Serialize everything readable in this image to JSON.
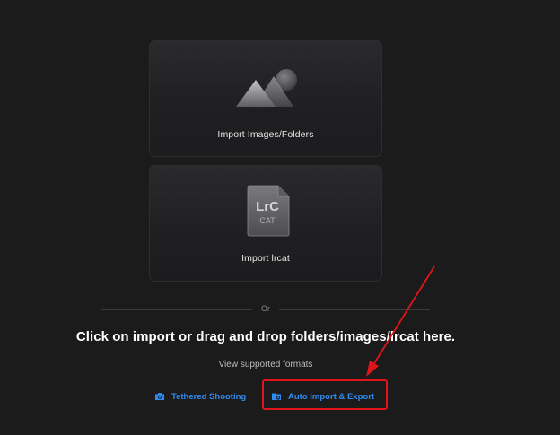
{
  "cards": {
    "import_images": {
      "label": "Import Images/Folders",
      "icon": "mountains-image-icon"
    },
    "import_lrcat": {
      "label": "Import lrcat",
      "icon": "lrcat-file-icon",
      "icon_text_top": "LrC",
      "icon_text_bottom": "CAT"
    }
  },
  "separator": {
    "text": "Or"
  },
  "instructions": "Click on import or drag and drop folders/images/lrcat here.",
  "formats_link": "View supported formats",
  "actions": {
    "tethered": {
      "label": "Tethered Shooting",
      "icon": "camera-icon"
    },
    "auto_import": {
      "label": "Auto Import & Export",
      "icon": "folder-sync-icon"
    }
  },
  "colors": {
    "background": "#1b1b1c",
    "accent_blue": "#2f8cf0",
    "annotation_red": "#e0141a"
  }
}
